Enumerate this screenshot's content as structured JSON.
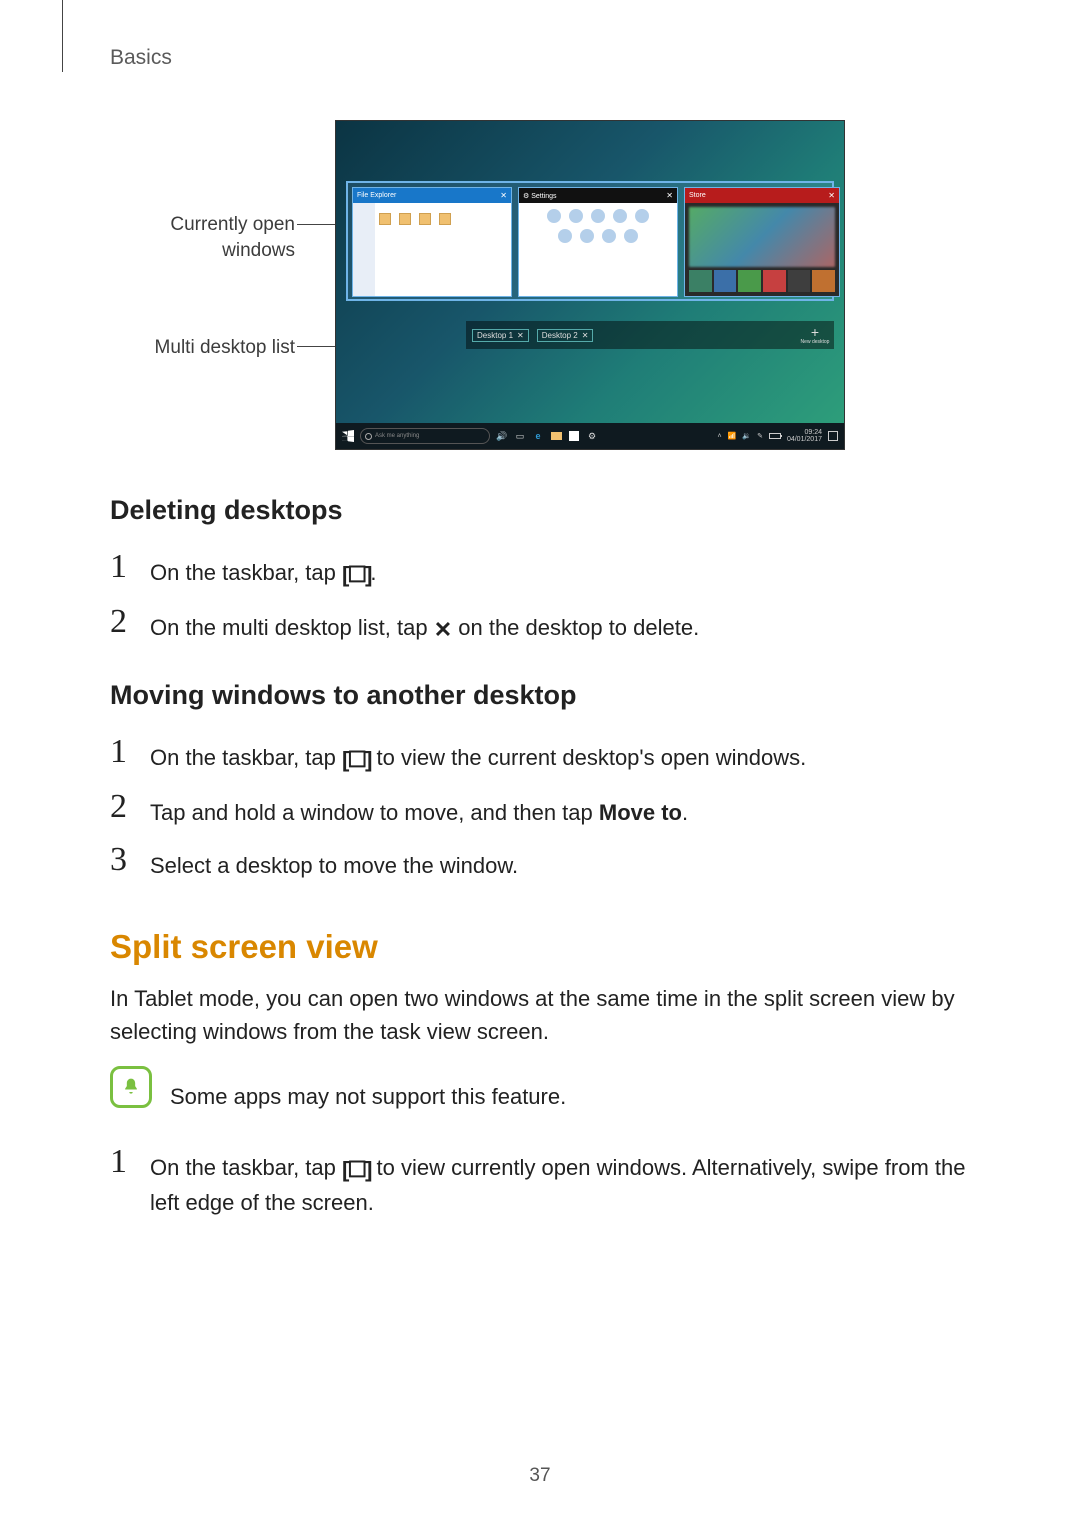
{
  "header": {
    "section": "Basics"
  },
  "diagram": {
    "label_open_windows": "Currently open\nwindows",
    "label_multi_desktop": "Multi desktop list",
    "win1_title": "File Explorer",
    "win2_title": "Settings",
    "win3_title": "Store",
    "close": "✕",
    "desktop_tabs": [
      "Desktop 1",
      "Desktop 2"
    ],
    "new_desktop": "New desktop",
    "search_placeholder": "Ask me anything",
    "clock_time": "09:24",
    "clock_date": "04/01/2017"
  },
  "sections": {
    "deleting_title": "Deleting desktops",
    "moving_title": "Moving windows to another desktop",
    "split_title": "Split screen view"
  },
  "steps": {
    "del1_a": "On the taskbar, tap ",
    "del1_b": ".",
    "del2_a": "On the multi desktop list, tap ",
    "del2_b": " on the desktop to delete.",
    "mov1_a": "On the taskbar, tap ",
    "mov1_b": " to view the current desktop's open windows.",
    "mov2_a": "Tap and hold a window to move, and then tap ",
    "mov2_bold": "Move to",
    "mov2_b": ".",
    "mov3": "Select a desktop to move the window.",
    "split_body": "In Tablet mode, you can open two windows at the same time in the split screen view by selecting windows from the task view screen.",
    "split_note": "Some apps may not support this feature.",
    "split1_a": "On the taskbar, tap ",
    "split1_b": " to view currently open windows. Alternatively, swipe from the left edge of the screen."
  },
  "icons": {
    "taskview_glyph": "[☐]",
    "x_glyph": "✕"
  },
  "page_number": "37"
}
